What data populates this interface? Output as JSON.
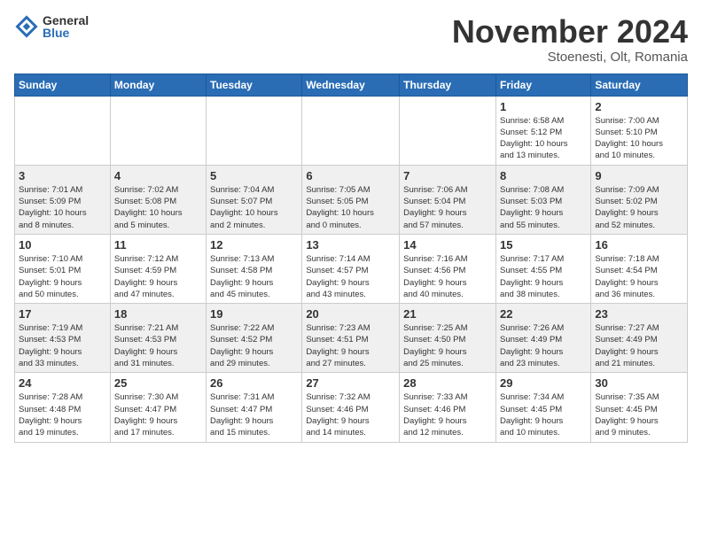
{
  "logo": {
    "general": "General",
    "blue": "Blue"
  },
  "title": "November 2024",
  "subtitle": "Stoenesti, Olt, Romania",
  "weekdays": [
    "Sunday",
    "Monday",
    "Tuesday",
    "Wednesday",
    "Thursday",
    "Friday",
    "Saturday"
  ],
  "weeks": [
    [
      {
        "day": "",
        "info": ""
      },
      {
        "day": "",
        "info": ""
      },
      {
        "day": "",
        "info": ""
      },
      {
        "day": "",
        "info": ""
      },
      {
        "day": "",
        "info": ""
      },
      {
        "day": "1",
        "info": "Sunrise: 6:58 AM\nSunset: 5:12 PM\nDaylight: 10 hours\nand 13 minutes."
      },
      {
        "day": "2",
        "info": "Sunrise: 7:00 AM\nSunset: 5:10 PM\nDaylight: 10 hours\nand 10 minutes."
      }
    ],
    [
      {
        "day": "3",
        "info": "Sunrise: 7:01 AM\nSunset: 5:09 PM\nDaylight: 10 hours\nand 8 minutes."
      },
      {
        "day": "4",
        "info": "Sunrise: 7:02 AM\nSunset: 5:08 PM\nDaylight: 10 hours\nand 5 minutes."
      },
      {
        "day": "5",
        "info": "Sunrise: 7:04 AM\nSunset: 5:07 PM\nDaylight: 10 hours\nand 2 minutes."
      },
      {
        "day": "6",
        "info": "Sunrise: 7:05 AM\nSunset: 5:05 PM\nDaylight: 10 hours\nand 0 minutes."
      },
      {
        "day": "7",
        "info": "Sunrise: 7:06 AM\nSunset: 5:04 PM\nDaylight: 9 hours\nand 57 minutes."
      },
      {
        "day": "8",
        "info": "Sunrise: 7:08 AM\nSunset: 5:03 PM\nDaylight: 9 hours\nand 55 minutes."
      },
      {
        "day": "9",
        "info": "Sunrise: 7:09 AM\nSunset: 5:02 PM\nDaylight: 9 hours\nand 52 minutes."
      }
    ],
    [
      {
        "day": "10",
        "info": "Sunrise: 7:10 AM\nSunset: 5:01 PM\nDaylight: 9 hours\nand 50 minutes."
      },
      {
        "day": "11",
        "info": "Sunrise: 7:12 AM\nSunset: 4:59 PM\nDaylight: 9 hours\nand 47 minutes."
      },
      {
        "day": "12",
        "info": "Sunrise: 7:13 AM\nSunset: 4:58 PM\nDaylight: 9 hours\nand 45 minutes."
      },
      {
        "day": "13",
        "info": "Sunrise: 7:14 AM\nSunset: 4:57 PM\nDaylight: 9 hours\nand 43 minutes."
      },
      {
        "day": "14",
        "info": "Sunrise: 7:16 AM\nSunset: 4:56 PM\nDaylight: 9 hours\nand 40 minutes."
      },
      {
        "day": "15",
        "info": "Sunrise: 7:17 AM\nSunset: 4:55 PM\nDaylight: 9 hours\nand 38 minutes."
      },
      {
        "day": "16",
        "info": "Sunrise: 7:18 AM\nSunset: 4:54 PM\nDaylight: 9 hours\nand 36 minutes."
      }
    ],
    [
      {
        "day": "17",
        "info": "Sunrise: 7:19 AM\nSunset: 4:53 PM\nDaylight: 9 hours\nand 33 minutes."
      },
      {
        "day": "18",
        "info": "Sunrise: 7:21 AM\nSunset: 4:53 PM\nDaylight: 9 hours\nand 31 minutes."
      },
      {
        "day": "19",
        "info": "Sunrise: 7:22 AM\nSunset: 4:52 PM\nDaylight: 9 hours\nand 29 minutes."
      },
      {
        "day": "20",
        "info": "Sunrise: 7:23 AM\nSunset: 4:51 PM\nDaylight: 9 hours\nand 27 minutes."
      },
      {
        "day": "21",
        "info": "Sunrise: 7:25 AM\nSunset: 4:50 PM\nDaylight: 9 hours\nand 25 minutes."
      },
      {
        "day": "22",
        "info": "Sunrise: 7:26 AM\nSunset: 4:49 PM\nDaylight: 9 hours\nand 23 minutes."
      },
      {
        "day": "23",
        "info": "Sunrise: 7:27 AM\nSunset: 4:49 PM\nDaylight: 9 hours\nand 21 minutes."
      }
    ],
    [
      {
        "day": "24",
        "info": "Sunrise: 7:28 AM\nSunset: 4:48 PM\nDaylight: 9 hours\nand 19 minutes."
      },
      {
        "day": "25",
        "info": "Sunrise: 7:30 AM\nSunset: 4:47 PM\nDaylight: 9 hours\nand 17 minutes."
      },
      {
        "day": "26",
        "info": "Sunrise: 7:31 AM\nSunset: 4:47 PM\nDaylight: 9 hours\nand 15 minutes."
      },
      {
        "day": "27",
        "info": "Sunrise: 7:32 AM\nSunset: 4:46 PM\nDaylight: 9 hours\nand 14 minutes."
      },
      {
        "day": "28",
        "info": "Sunrise: 7:33 AM\nSunset: 4:46 PM\nDaylight: 9 hours\nand 12 minutes."
      },
      {
        "day": "29",
        "info": "Sunrise: 7:34 AM\nSunset: 4:45 PM\nDaylight: 9 hours\nand 10 minutes."
      },
      {
        "day": "30",
        "info": "Sunrise: 7:35 AM\nSunset: 4:45 PM\nDaylight: 9 hours\nand 9 minutes."
      }
    ]
  ]
}
